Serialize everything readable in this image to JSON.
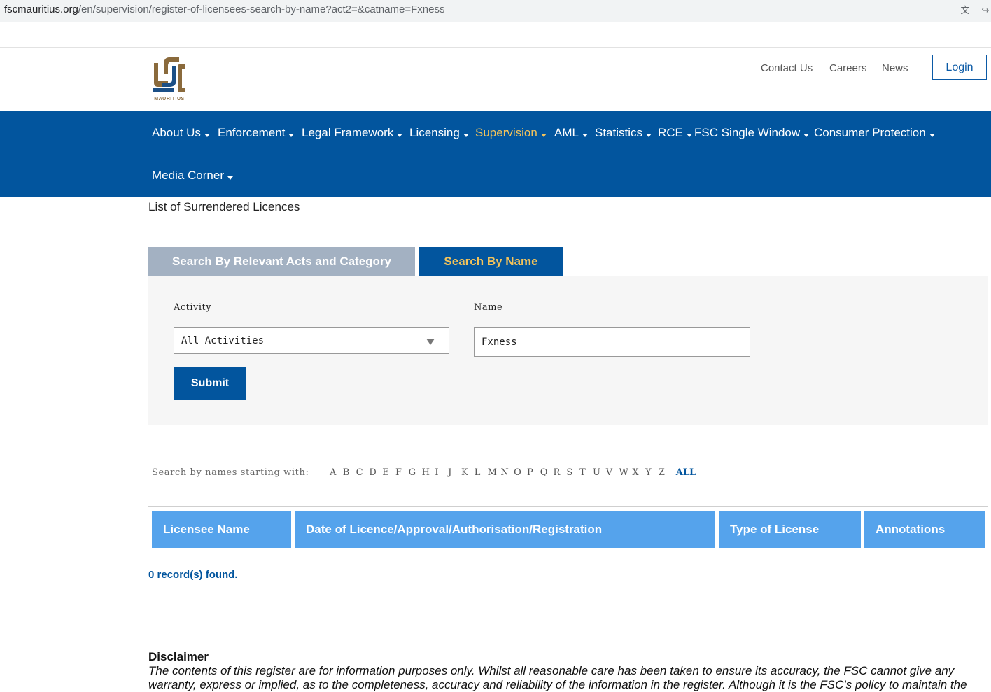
{
  "browser": {
    "url_host": "fscmauritius.org",
    "url_path": "/en/supervision/register-of-licensees-search-by-name?act2=&catname=Fxness"
  },
  "header": {
    "logo_text": "MAURITIUS",
    "links": [
      "Contact Us",
      "Careers",
      "News"
    ],
    "login_label": "Login"
  },
  "nav": {
    "items": [
      "About Us",
      "Enforcement",
      "Legal Framework",
      "Licensing",
      "Supervision",
      "AML",
      "Statistics",
      "RCE",
      "FSC Single Window",
      "Consumer Protection",
      "Media Corner"
    ],
    "active": "Supervision"
  },
  "page": {
    "heading": "List of Surrendered Licences"
  },
  "tabs": {
    "acts": "Search By Relevant Acts and Category",
    "name": "Search By Name"
  },
  "form": {
    "activity_label": "Activity",
    "activity_value": "All Activities",
    "name_label": "Name",
    "name_value": "Fxness",
    "submit_label": "Submit"
  },
  "alphabet": {
    "label": "Search by names starting with:",
    "letters": [
      "A",
      "B",
      "C",
      "D",
      "E",
      "F",
      "G",
      "H",
      "I",
      "J",
      "K",
      "L",
      "M",
      "N",
      "O",
      "P",
      "Q",
      "R",
      "S",
      "T",
      "U",
      "V",
      "W",
      "X",
      "Y",
      "Z"
    ],
    "all_label": "ALL"
  },
  "table": {
    "headers": [
      "Licensee Name",
      "Date of Licence/Approval/Authorisation/Registration",
      "Type of License",
      "Annotations"
    ]
  },
  "results": {
    "count_text": "0 record(s) found."
  },
  "disclaimer": {
    "title": "Disclaimer",
    "text": "The contents of this register are for information purposes only. Whilst all reasonable care has been taken to ensure its accuracy, the FSC cannot give any warranty, express or implied, as to the completeness, accuracy and reliability of the information in the register. Although it is the FSC's policy to maintain the"
  },
  "colors": {
    "brand_blue": "#02559e",
    "active_nav": "#f3c35b",
    "table_header": "#55a3ec",
    "tab_inactive": "#a3b1c2",
    "logo_gold": "#8a6a3c"
  }
}
